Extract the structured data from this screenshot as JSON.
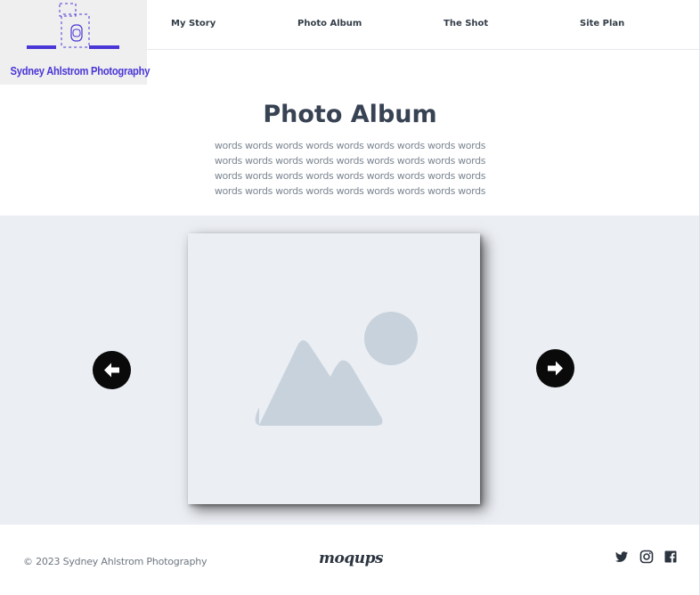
{
  "logo": {
    "text": "Sydney Ahlstrom Photography",
    "accent_color": "#4936d6"
  },
  "nav": {
    "items": [
      {
        "label": "My Story"
      },
      {
        "label": "Photo Album"
      },
      {
        "label": "The Shot"
      },
      {
        "label": "Site Plan"
      }
    ]
  },
  "hero": {
    "title": "Photo Album",
    "paragraph": "words words words words words words words words words words words words words words words words words words words words words words words words words words words words words words words words words words words words"
  },
  "gallery": {
    "image": "image-placeholder-icon",
    "prev_icon": "arrow-left-icon",
    "next_icon": "arrow-right-icon"
  },
  "footer": {
    "copyright": "© 2023 Sydney Ahlstrom Photography",
    "brand": "moqups",
    "social": [
      "twitter-icon",
      "instagram-icon",
      "facebook-icon"
    ]
  }
}
